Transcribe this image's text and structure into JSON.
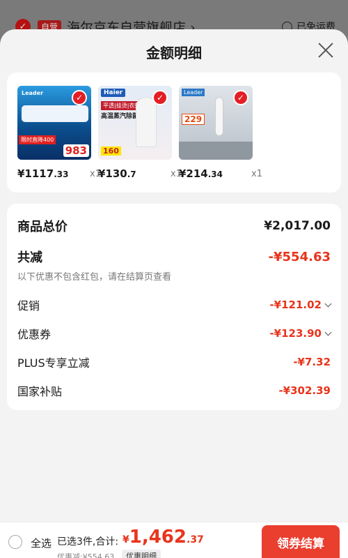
{
  "background": {
    "store_badge": "自营",
    "store_name": "海尔京东自营旗舰店",
    "store_arrow": "›",
    "shipping_text": "已免运费"
  },
  "sheet": {
    "title": "金额明细"
  },
  "products": [
    {
      "price_int": "¥1117",
      "price_dec": ".33",
      "qty": "x1",
      "thumb_brand": "Leader",
      "thumb_tag": "限时直降400",
      "thumb_price": "983"
    },
    {
      "price_int": "¥130",
      "price_dec": ".7",
      "qty": "x1",
      "thumb_brand": "Haier",
      "thumb_line1": "平透|挂烫|衣架",
      "thumb_line2": "高温蒸汽除菌",
      "thumb_price": "160"
    },
    {
      "price_int": "¥214",
      "price_dec": ".34",
      "qty": "x1",
      "thumb_brand": "Leader",
      "thumb_price": "229"
    }
  ],
  "summary": {
    "total_label": "商品总价",
    "total_value": "¥2,017.00",
    "reduce_label": "共减",
    "reduce_value": "-¥554.63",
    "note": "以下优惠不包含红包，请在结算页查看",
    "items": [
      {
        "label": "促销",
        "value": "-¥121.02"
      },
      {
        "label": "优惠券",
        "value": "-¥123.90"
      },
      {
        "label": "PLUS专享立减",
        "value": "-¥7.32"
      },
      {
        "label": "国家补贴",
        "value": "-¥302.39"
      }
    ]
  },
  "bottom": {
    "select_all": "全选",
    "selected_info": "已选3件,合计:",
    "grand_currency": "¥",
    "grand_int": "1,462",
    "grand_dec": ".37",
    "discount_line": "优惠减:¥554.63",
    "detail_chip": "优惠明细",
    "checkout_label": "领券结算"
  },
  "colors": {
    "accent_red": "#e8341c",
    "button_red": "#ea3e2f"
  }
}
